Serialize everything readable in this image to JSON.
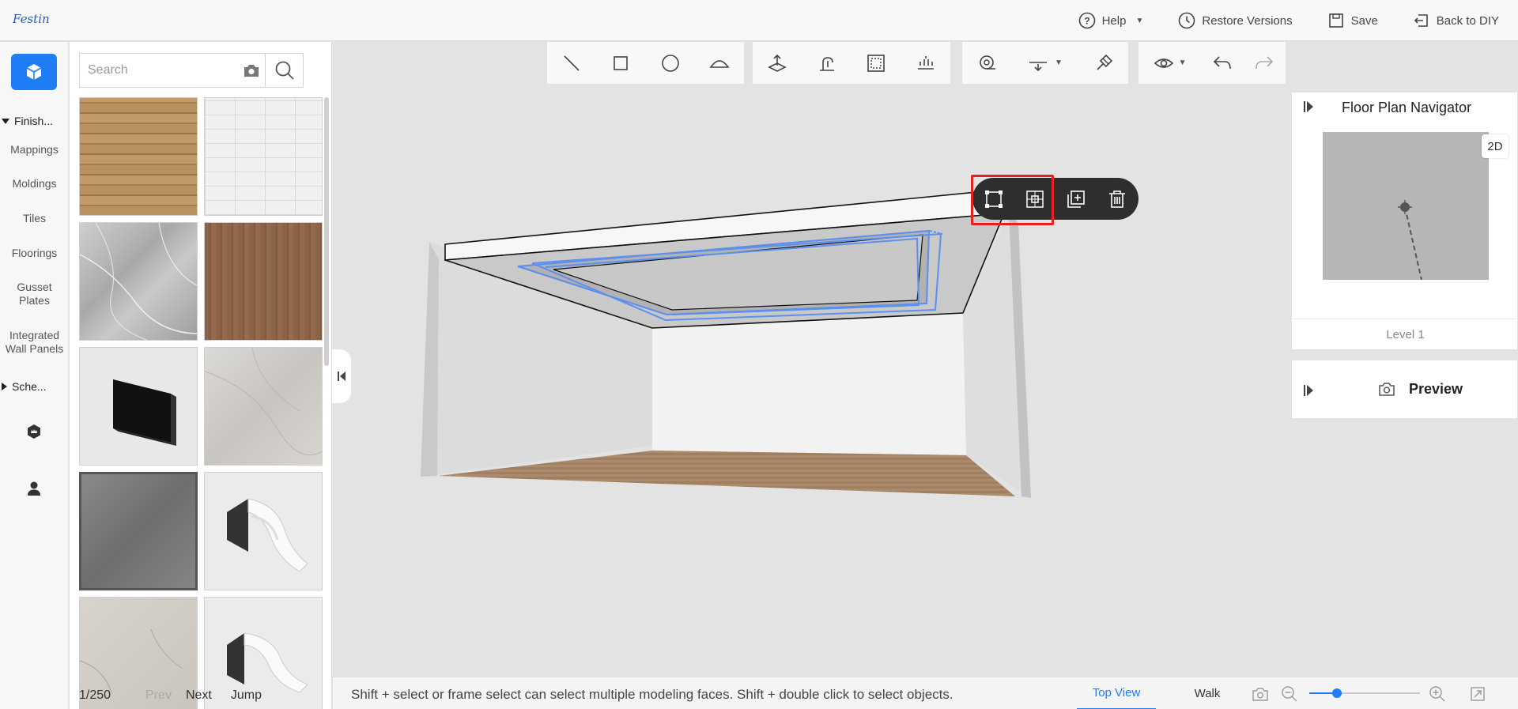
{
  "app": {
    "logo_text": "Festin"
  },
  "topbar": {
    "help_label": "Help",
    "restore_label": "Restore Versions",
    "save_label": "Save",
    "back_label": "Back to DIY"
  },
  "rail": {
    "group_finish": "Finish...",
    "items": [
      "Mappings",
      "Moldings",
      "Tiles",
      "Floorings",
      "Gusset Plates",
      "Integrated Wall Panels"
    ],
    "group_schemes": "Sche..."
  },
  "catalog": {
    "search_placeholder": "Search",
    "tiles": [
      {
        "name": "wood-planks",
        "color": "#b28a5c"
      },
      {
        "name": "white-brick",
        "color": "#e6e6e6"
      },
      {
        "name": "grey-marble",
        "color": "#bcbcbc"
      },
      {
        "name": "walnut-wood",
        "color": "#8b6448"
      },
      {
        "name": "black-panel",
        "color": "#e8e8e8"
      },
      {
        "name": "light-marble",
        "color": "#d2cfcb"
      },
      {
        "name": "dark-stone",
        "color": "#7a7a7a"
      },
      {
        "name": "crown-molding",
        "color": "#ebebeb"
      },
      {
        "name": "beige-stone",
        "color": "#d3cfc8"
      },
      {
        "name": "molding-profile",
        "color": "#ebebeb"
      }
    ],
    "pager": {
      "page": "1/250",
      "prev": "Prev",
      "next": "Next",
      "jump": "Jump"
    }
  },
  "navigator": {
    "title": "Floor Plan Navigator",
    "mode_badge": "2D",
    "level": "Level 1"
  },
  "preview": {
    "label": "Preview"
  },
  "bottombar": {
    "hint": "Shift + select or frame select can select multiple modeling faces. Shift + double click to select objects.",
    "tab_top": "Top View",
    "tab_walk": "Walk",
    "zoom_level": 0.25
  },
  "colors": {
    "accent": "#1f7ef5",
    "highlight": "#e5231c",
    "selection": "#5b8ff0"
  }
}
